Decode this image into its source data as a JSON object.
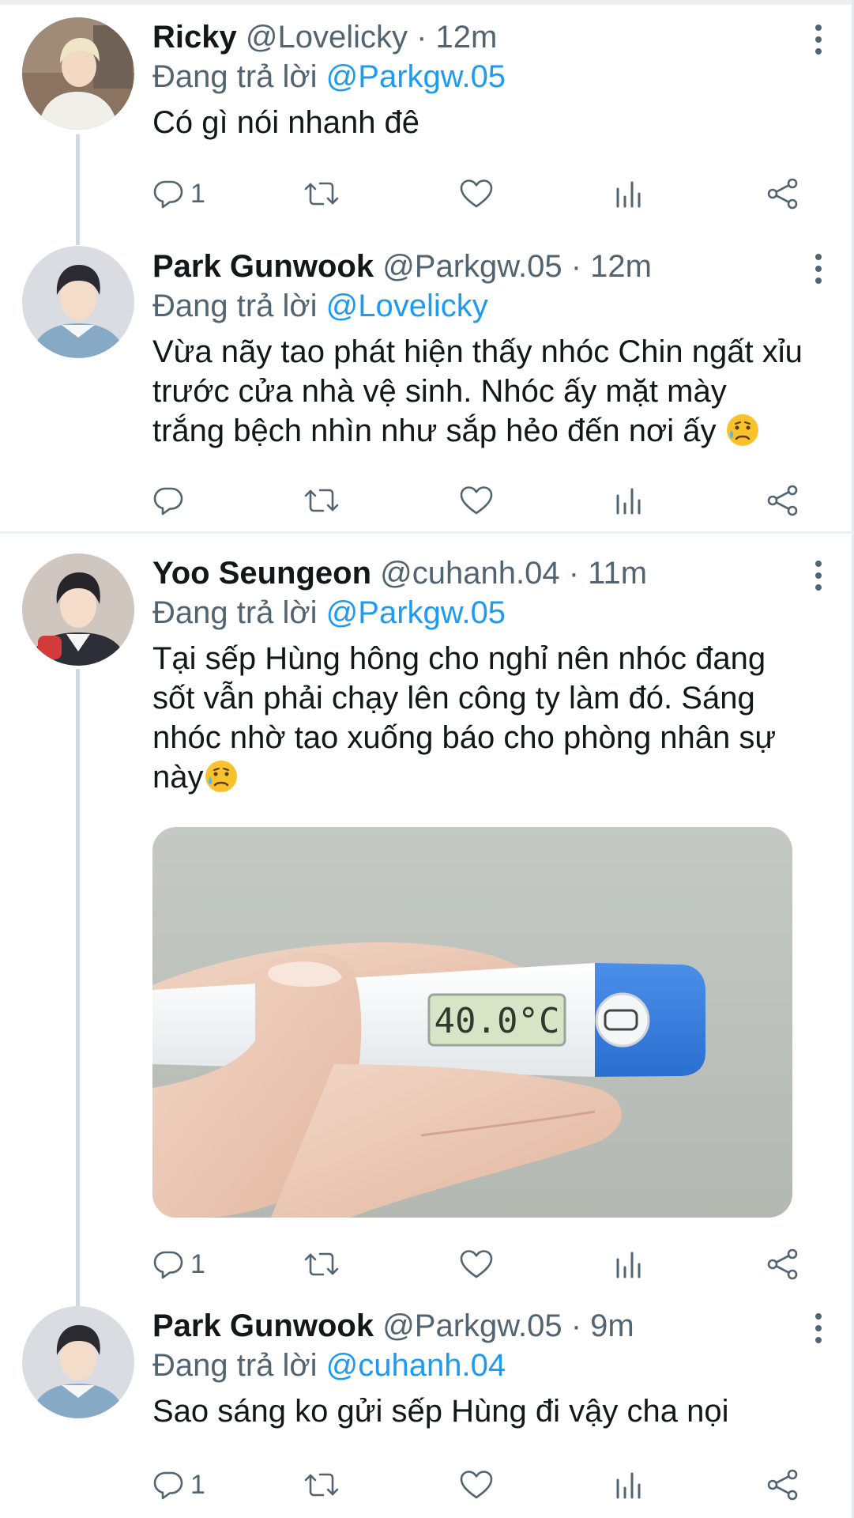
{
  "reply_prefix": "Đang trả lời",
  "tweets": [
    {
      "name": "Ricky",
      "handle": "@Lovelicky",
      "time": "· 12m",
      "reply_to": "@Parkgw.05",
      "text": "Có gì nói nhanh đê",
      "reply_count": "1"
    },
    {
      "name": "Park Gunwook",
      "handle": "@Parkgw.05",
      "time": "· 12m",
      "reply_to": "@Lovelicky",
      "text": "Vừa nãy tao phát hiện thấy nhóc Chin ngất xỉu trước cửa nhà vệ sinh. Nhóc ấy mặt mày trắng bệch nhìn như sắp hẻo đến nơi ấy",
      "reply_count": ""
    },
    {
      "name": "Yoo Seungeon",
      "handle": "@cuhanh.04",
      "time": "· 11m",
      "reply_to": "@Parkgw.05",
      "text": "Tại sếp Hùng hông cho nghỉ nên nhóc đang sốt vẫn phải chạy lên công ty làm đó. Sáng nhóc nhờ tao xuống báo cho phòng nhân sự này",
      "reply_count": "1",
      "media": {
        "thermometer_reading": "40.0°C"
      }
    },
    {
      "name": "Park Gunwook",
      "handle": "@Parkgw.05",
      "time": "· 9m",
      "reply_to": "@cuhanh.04",
      "text": "Sao sáng ko gửi sếp Hùng đi vậy cha nọi",
      "reply_count": "1"
    }
  ],
  "colors": {
    "accent": "#1d9bf0",
    "secondary_text": "#536471",
    "primary_text": "#14171a",
    "thread_line": "#cfd9de"
  },
  "icons": [
    "reply-icon",
    "retweet-icon",
    "like-icon",
    "views-icon",
    "share-icon",
    "more-icon"
  ]
}
